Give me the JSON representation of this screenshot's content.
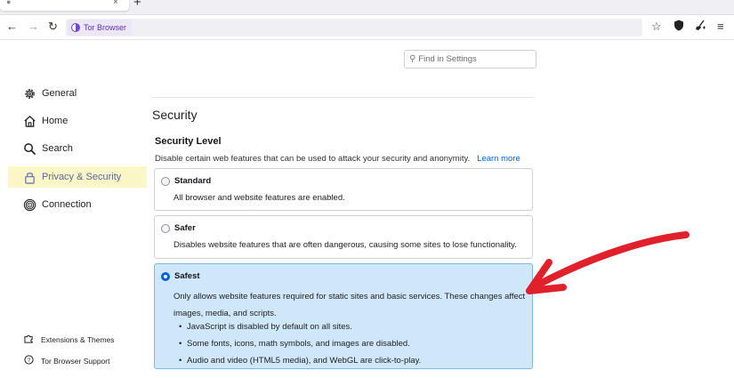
{
  "browser": {
    "identity_label": "Tor Browser",
    "new_tab_symbol": "+",
    "close_symbol": "×"
  },
  "settings": {
    "find_placeholder": "Find in Settings"
  },
  "sidebar": {
    "items": [
      {
        "label": "General",
        "icon": "gear-icon"
      },
      {
        "label": "Home",
        "icon": "home-icon"
      },
      {
        "label": "Search",
        "icon": "search-icon"
      },
      {
        "label": "Privacy & Security",
        "icon": "lock-icon",
        "active": true
      },
      {
        "label": "Connection",
        "icon": "onion-connection-icon"
      }
    ],
    "footer": [
      {
        "label": "Extensions & Themes",
        "icon": "puzzle-icon"
      },
      {
        "label": "Tor Browser Support",
        "icon": "help-icon"
      }
    ]
  },
  "security": {
    "section_title": "Security",
    "level_title": "Security Level",
    "level_desc": "Disable certain web features that can be used to attack your security and anonymity.",
    "learn_more": "Learn more",
    "options": {
      "standard": {
        "title": "Standard",
        "desc": "All browser and website features are enabled."
      },
      "safer": {
        "title": "Safer",
        "desc": "Disables website features that are often dangerous, causing some sites to lose functionality."
      },
      "safest": {
        "title": "Safest",
        "desc": "Only allows website features required for static sites and basic services. These changes affect images, media, and scripts.",
        "bullets": [
          "JavaScript is disabled by default on all sites.",
          "Some fonts, icons, math symbols, and images are disabled.",
          "Audio and video (HTML5 media), and WebGL are click-to-play."
        ],
        "selected": true
      }
    }
  },
  "colors": {
    "accent": "#0061e0",
    "selected_card": "#cfe7fb",
    "active_highlight": "#fbf6c5",
    "annotation_arrow": "#e0212b"
  }
}
